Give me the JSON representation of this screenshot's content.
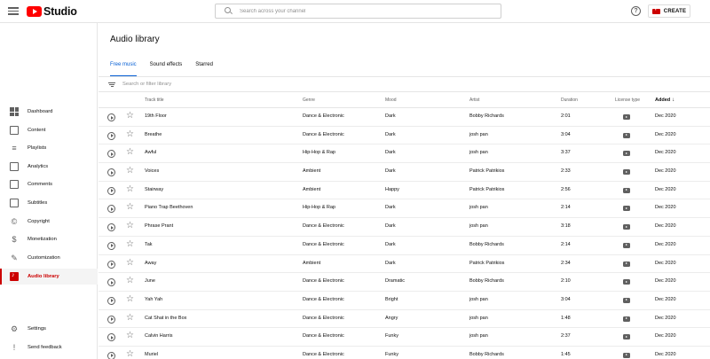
{
  "app": {
    "name": "Studio",
    "search_placeholder": "Search across your channel",
    "create_label": "CREATE",
    "brand_color": "#ff0000"
  },
  "sidebar": {
    "items": [
      {
        "label": "Dashboard",
        "icon": "dashboard-icon"
      },
      {
        "label": "Content",
        "icon": "content-icon"
      },
      {
        "label": "Playlists",
        "icon": "playlists-icon"
      },
      {
        "label": "Analytics",
        "icon": "analytics-icon"
      },
      {
        "label": "Comments",
        "icon": "comments-icon"
      },
      {
        "label": "Subtitles",
        "icon": "subtitles-icon"
      },
      {
        "label": "Copyright",
        "icon": "copyright-icon"
      },
      {
        "label": "Monetization",
        "icon": "monetization-icon"
      },
      {
        "label": "Customization",
        "icon": "customization-icon"
      },
      {
        "label": "Audio library",
        "icon": "audio-library-icon",
        "active": true
      }
    ],
    "bottom": [
      {
        "label": "Settings",
        "icon": "gear-icon"
      },
      {
        "label": "Send feedback",
        "icon": "feedback-icon"
      }
    ],
    "active_color": "#cc0000"
  },
  "main": {
    "title": "Audio library",
    "tabs": [
      {
        "label": "Free music",
        "active": true
      },
      {
        "label": "Sound effects"
      },
      {
        "label": "Starred"
      }
    ],
    "filter_placeholder": "Search or filter library",
    "accent_color": "#065fd4"
  },
  "table": {
    "headers": {
      "title": "Track title",
      "genre": "Genre",
      "mood": "Mood",
      "artist": "Artist",
      "duration": "Duration",
      "license": "License type",
      "added": "Added"
    },
    "sort": {
      "column": "Added",
      "direction": "descending"
    },
    "rows": [
      {
        "title": "19th Floor",
        "genre": "Dance & Electronic",
        "mood": "Dark",
        "artist": "Bobby Richards",
        "duration": "2:01",
        "added": "Dec 2020"
      },
      {
        "title": "Breathe",
        "genre": "Dance & Electronic",
        "mood": "Dark",
        "artist": "josh pan",
        "duration": "3:04",
        "added": "Dec 2020"
      },
      {
        "title": "Awful",
        "genre": "Hip-Hop & Rap",
        "mood": "Dark",
        "artist": "josh pan",
        "duration": "3:37",
        "added": "Dec 2020"
      },
      {
        "title": "Voices",
        "genre": "Ambient",
        "mood": "Dark",
        "artist": "Patrick Patrikios",
        "duration": "2:33",
        "added": "Dec 2020"
      },
      {
        "title": "Stairway",
        "genre": "Ambient",
        "mood": "Happy",
        "artist": "Patrick Patrikios",
        "duration": "2:56",
        "added": "Dec 2020"
      },
      {
        "title": "Piano Trap Beethoven",
        "genre": "Hip-Hop & Rap",
        "mood": "Dark",
        "artist": "josh pan",
        "duration": "2:14",
        "added": "Dec 2020"
      },
      {
        "title": "Phrase Prant",
        "genre": "Dance & Electronic",
        "mood": "Dark",
        "artist": "josh pan",
        "duration": "3:18",
        "added": "Dec 2020"
      },
      {
        "title": "Tak",
        "genre": "Dance & Electronic",
        "mood": "Dark",
        "artist": "Bobby Richards",
        "duration": "2:14",
        "added": "Dec 2020"
      },
      {
        "title": "Away",
        "genre": "Ambient",
        "mood": "Dark",
        "artist": "Patrick Patrikios",
        "duration": "2:34",
        "added": "Dec 2020"
      },
      {
        "title": "June",
        "genre": "Dance & Electronic",
        "mood": "Dramatic",
        "artist": "Bobby Richards",
        "duration": "2:10",
        "added": "Dec 2020"
      },
      {
        "title": "Yah Yah",
        "genre": "Dance & Electronic",
        "mood": "Bright",
        "artist": "josh pan",
        "duration": "3:04",
        "added": "Dec 2020"
      },
      {
        "title": "Cat Shat in the Box",
        "genre": "Dance & Electronic",
        "mood": "Angry",
        "artist": "josh pan",
        "duration": "1:48",
        "added": "Dec 2020"
      },
      {
        "title": "Calvin Harris",
        "genre": "Dance & Electronic",
        "mood": "Funky",
        "artist": "josh pan",
        "duration": "2:37",
        "added": "Dec 2020"
      },
      {
        "title": "Muriel",
        "genre": "Dance & Electronic",
        "mood": "Funky",
        "artist": "Bobby Richards",
        "duration": "1:45",
        "added": "Dec 2020"
      }
    ]
  }
}
